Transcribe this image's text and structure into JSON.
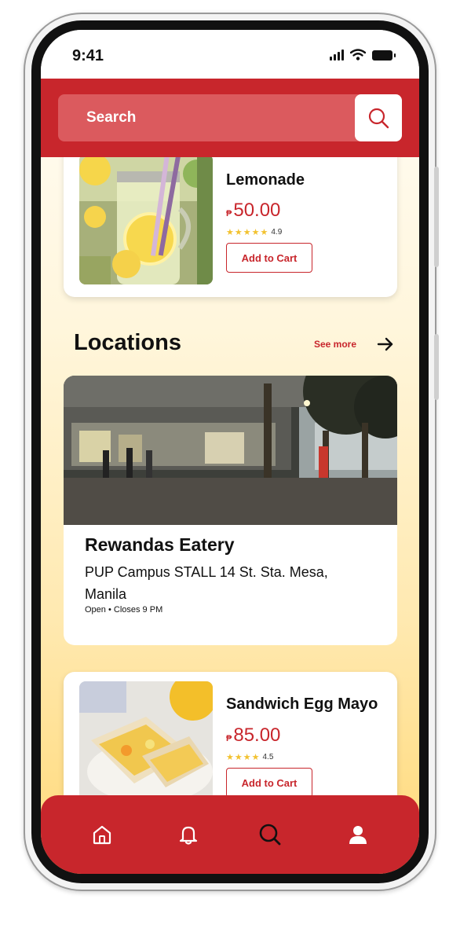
{
  "status_bar": {
    "time": "9:41"
  },
  "search": {
    "placeholder": "Search"
  },
  "products": [
    {
      "name": "Lemonade",
      "currency": "₱",
      "price": "50.00",
      "rating": "4.9",
      "stars": 5,
      "cart_label": "Add to Cart"
    },
    {
      "name": "Sandwich Egg Mayo",
      "currency": "₱",
      "price": "85.00",
      "rating": "4.5",
      "stars": 4,
      "cart_label": "Add to Cart"
    }
  ],
  "locations": {
    "title": "Locations",
    "see_more": "See more",
    "card": {
      "name": "Rewandas Eatery",
      "address": "PUP Campus STALL 14 St. Sta. Mesa, Manila",
      "hours": "Open • Closes 9 PM"
    }
  },
  "bottom_nav": {
    "items": [
      {
        "icon": "home-icon"
      },
      {
        "icon": "bell-icon"
      },
      {
        "icon": "search-icon"
      },
      {
        "icon": "profile-icon"
      }
    ]
  },
  "colors": {
    "brand_red": "#c8262c",
    "search_bg": "#db5a5e",
    "gradient_bottom": "#ffd978"
  }
}
